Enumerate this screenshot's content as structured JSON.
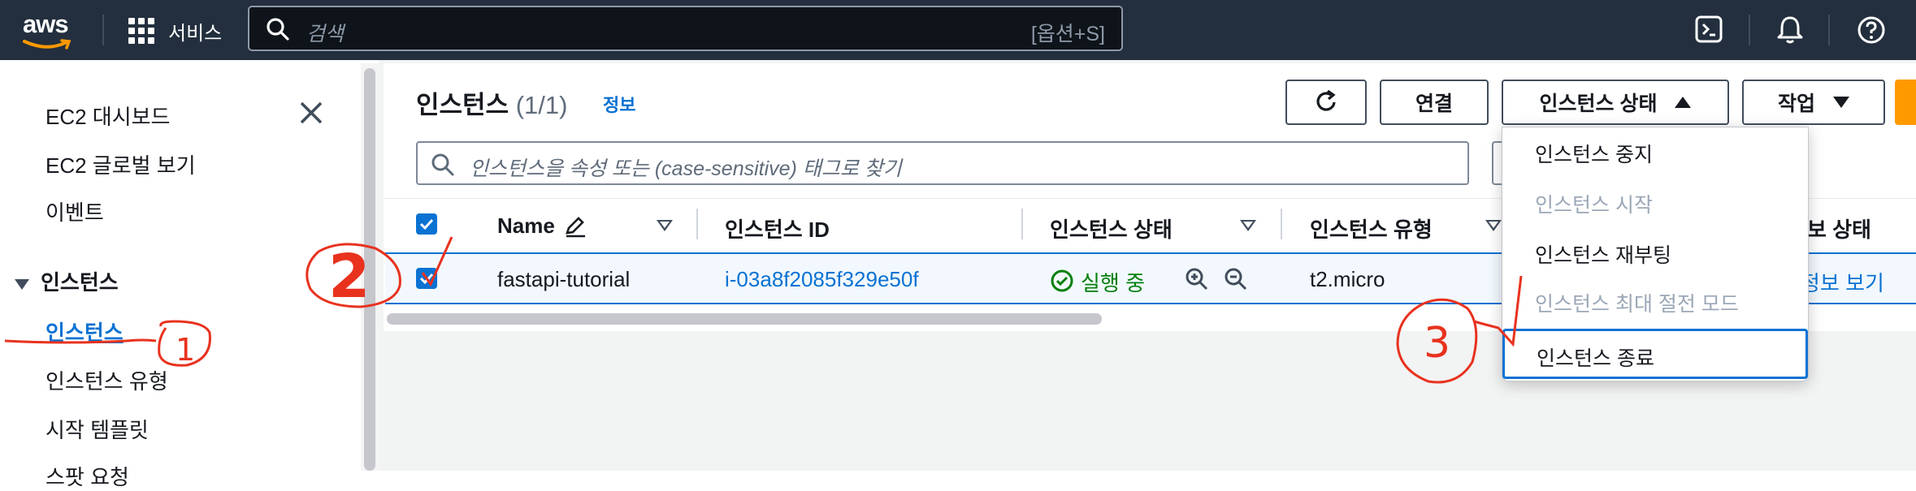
{
  "topbar": {
    "logo_text": "aws",
    "services_label": "서비스",
    "search_placeholder": "검색",
    "search_shortcut": "[옵션+S]",
    "icons": [
      "grid-icon",
      "search-icon",
      "cloudshell-icon",
      "bell-icon",
      "help-icon"
    ]
  },
  "sidebar": {
    "items": [
      {
        "label": "EC2 대시보드"
      },
      {
        "label": "EC2 글로벌 보기"
      },
      {
        "label": "이벤트"
      }
    ],
    "section_label": "인스턴스",
    "sub_items": [
      {
        "label": "인스턴스",
        "active": true
      },
      {
        "label": "인스턴스 유형"
      },
      {
        "label": "시작 템플릿"
      },
      {
        "label": "스팟 요청"
      }
    ]
  },
  "panel": {
    "title": "인스턴스",
    "count": "(1/1)",
    "info_link": "정보",
    "buttons": {
      "connect": "연결",
      "instance_state": "인스턴스 상태",
      "actions": "작업"
    },
    "filter_placeholder": "인스턴스을 속성 또는 (case-sensitive) 태그로 찾기"
  },
  "table": {
    "columns": [
      "Name",
      "인스턴스 ID",
      "인스턴스 상태",
      "인스턴스 유형",
      "정보 상태"
    ],
    "rows": [
      {
        "name": "fastapi-tutorial",
        "instance_id": "i-03a8f2085f329e50f",
        "state": "실행 중",
        "type": "t2.micro",
        "status_link": "정보 보기",
        "selected": true
      }
    ]
  },
  "dropdown": {
    "items": [
      {
        "label": "인스턴스 중지",
        "disabled": false
      },
      {
        "label": "인스턴스 시작",
        "disabled": true
      },
      {
        "label": "인스턴스 재부팅",
        "disabled": false
      },
      {
        "label": "인스턴스 최대 절전 모드",
        "disabled": true
      },
      {
        "label": "인스턴스 종료",
        "disabled": false,
        "focused": true
      }
    ]
  },
  "annotations": {
    "num_1": "1",
    "num_2": "2",
    "num_3": "3",
    "color": "#e8321e"
  },
  "colors": {
    "topbar": "#232f3e",
    "link": "#0972d3",
    "running": "#037f0c",
    "accent": "#ff9900"
  }
}
